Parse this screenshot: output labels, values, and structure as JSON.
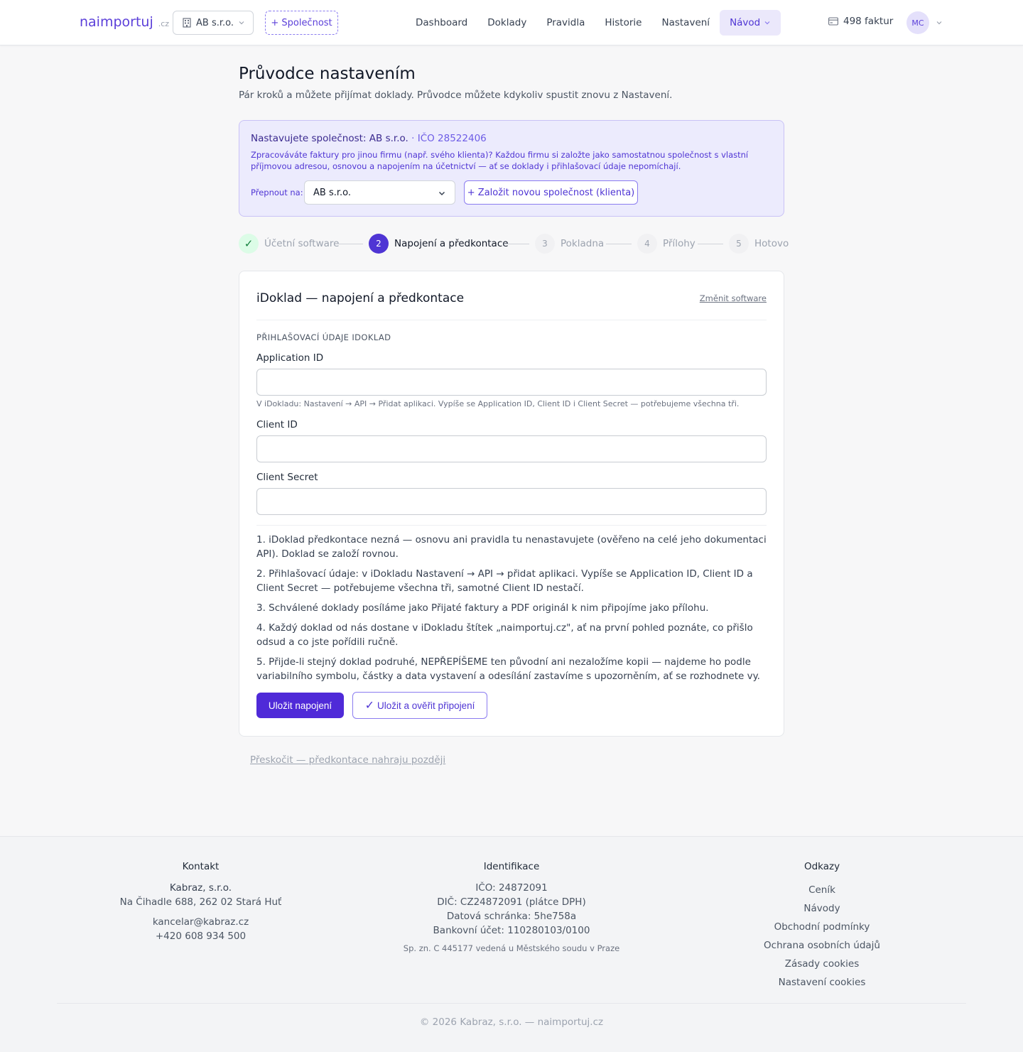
{
  "header": {
    "logo": "naimportuj",
    "logo_tld": ".cz",
    "company": "AB s.r.o.",
    "add_company": "+ Společnost",
    "nav": [
      "Dashboard",
      "Doklady",
      "Pravidla",
      "Historie",
      "Nastavení",
      "Návod"
    ],
    "nav_active": "Návod",
    "invoice_count": "498 faktur",
    "avatar_initials": "MC"
  },
  "page": {
    "title": "Průvodce nastavením",
    "subtitle": "Pár kroků a můžete přijímat doklady. Průvodce můžete kdykoliv spustit znovu z Nastavení."
  },
  "notice": {
    "title": "Nastavujete společnost: AB s.r.o.",
    "ico": "· IČO 28522406",
    "text": "Zpracováváte faktury pro jinou firmu (např. svého klienta)? Každou firmu si založte jako samostatnou společnost s vlastní příjmovou adresou, osnovou a napojením na účetnictví — ať se doklady i přihlašovací údaje nepomíchají.",
    "switch_label": "Přepnout na:",
    "switch_value": "AB s.r.o.",
    "new_client": "+ Založit novou společnost (klienta)"
  },
  "steps": [
    {
      "num": "✓",
      "label": "Účetní software",
      "state": "done"
    },
    {
      "num": "2",
      "label": "Napojení a předkontace",
      "state": "current"
    },
    {
      "num": "3",
      "label": "Pokladna",
      "state": "todo"
    },
    {
      "num": "4",
      "label": "Přílohy",
      "state": "todo"
    },
    {
      "num": "5",
      "label": "Hotovo",
      "state": "todo"
    }
  ],
  "card": {
    "title": "iDoklad — napojení a předkontace",
    "change_software": "Změnit software",
    "section": "Přihlašovací údaje iDoklad",
    "fields": [
      {
        "label": "Application ID",
        "value": "",
        "hint": "V iDokladu: Nastavení → API → Přidat aplikaci. Vypíše se Application ID, Client ID i Client Secret — potřebujeme všechna tři."
      },
      {
        "label": "Client ID",
        "value": "",
        "hint": ""
      },
      {
        "label": "Client Secret",
        "value": "",
        "hint": ""
      }
    ],
    "notes": [
      "1. iDoklad předkontace nezná — osnovu ani pravidla tu nenastavujete (ověřeno na celé jeho dokumentaci API). Doklad se založí rovnou.",
      "2. Přihlašovací údaje: v iDokladu Nastavení → API → přidat aplikaci. Vypíše se Application ID, Client ID a Client Secret — potřebujeme všechna tři, samotné Client ID nestačí.",
      "3. Schválené doklady posíláme jako Přijaté faktury a PDF originál k nim připojíme jako přílohu.",
      "4. Každý doklad od nás dostane v iDokladu štítek „naimportuj.cz\", ať na první pohled poznáte, co přišlo odsud a co jste pořídili ručně.",
      "5. Přijde-li stejný doklad podruhé, NEPŘEPÍŠEME ten původní ani nezaložíme kopii — najdeme ho podle variabilního symbolu, částky a data vystavení a odesílání zastavíme s upozorněním, ať se rozhodnete vy."
    ],
    "save_label": "Uložit napojení",
    "verify_label": "Uložit a ověřit připojení"
  },
  "skip": "Přeskočit — předkontace nahraju později",
  "footer": {
    "contact": {
      "title": "Kontakt",
      "company": "Kabraz, s.r.o.",
      "address": "Na Čihadle 688, 262 02 Stará Huť",
      "email": "kancelar@kabraz.cz",
      "phone": "+420 608 934 500"
    },
    "ident": {
      "title": "Identifikace",
      "ico": "IČO: 24872091",
      "dic": "DIČ: CZ24872091 (plátce DPH)",
      "databox": "Datová schránka: 5he758a",
      "bank": "Bankovní účet: 110280103/0100",
      "register": "Sp. zn. C 445177 vedená u Městského soudu v Praze"
    },
    "links": {
      "title": "Odkazy",
      "items": [
        "Ceník",
        "Návody",
        "Obchodní podmínky",
        "Ochrana osobních údajů",
        "Zásady cookies",
        "Nastavení cookies"
      ]
    },
    "copyright": "© 2026 Kabraz, s.r.o. — naimportuj.cz"
  },
  "colors": {
    "accent": "#4f35d4",
    "notice_bg": "#ecebfd",
    "done": "#15803d"
  }
}
